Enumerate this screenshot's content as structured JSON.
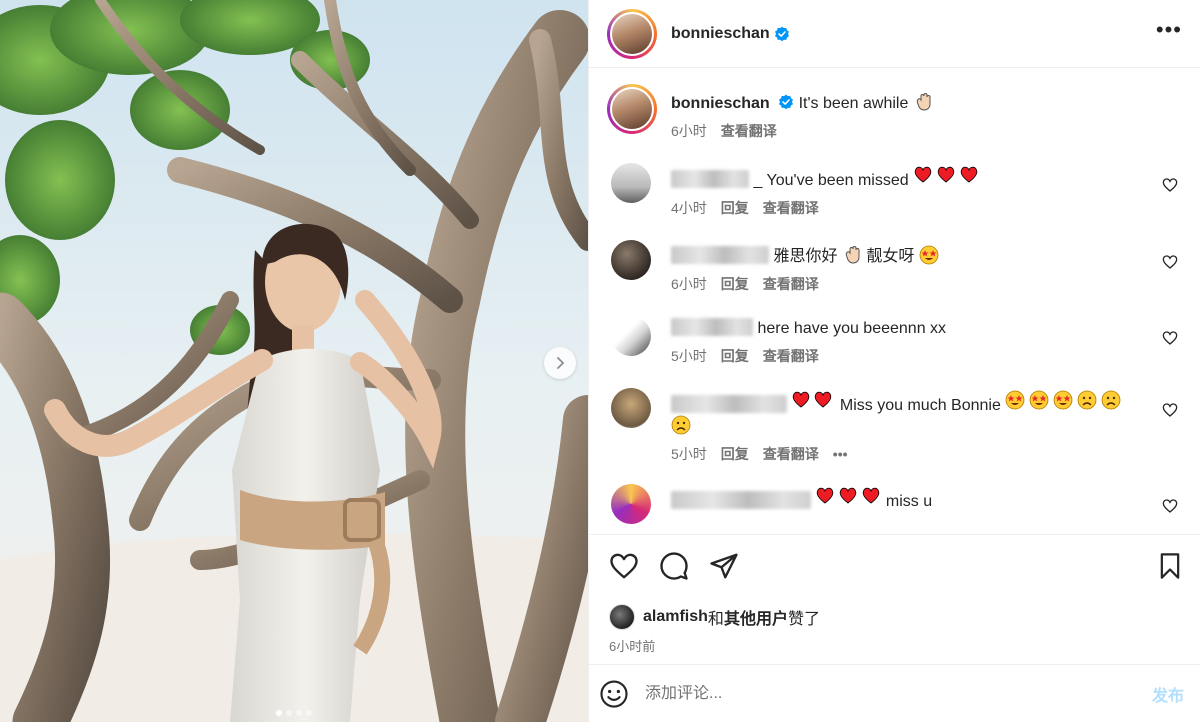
{
  "post": {
    "author": "bonnieschan",
    "caption": "It's been awhile",
    "caption_time": "6小时",
    "see_translation": "查看翻译",
    "reply": "回复",
    "carousel": {
      "slides": 4,
      "active_index": 0
    }
  },
  "comments": [
    {
      "text": "_ You've been missed",
      "emoji": [
        "heart",
        "heart",
        "heart"
      ],
      "time": "4小时"
    },
    {
      "text": "雅思你好",
      "tail": "靓女呀",
      "time": "6小时"
    },
    {
      "text": "here have you beeennn xx",
      "time": "5小时"
    },
    {
      "text": "Miss you much Bonnie",
      "time": "5小时",
      "more": "•••"
    },
    {
      "text": "miss u"
    }
  ],
  "likes": {
    "user": "alamfish",
    "joiner": "和",
    "others": "其他用户",
    "suffix": "赞了",
    "time": "6小时前"
  },
  "add_comment": {
    "placeholder": "添加评论...",
    "post_label": "发布"
  },
  "colors": {
    "heart_red": "#ed1c24",
    "verified_blue": "#0095f6",
    "post_disabled": "#b2dffc"
  }
}
